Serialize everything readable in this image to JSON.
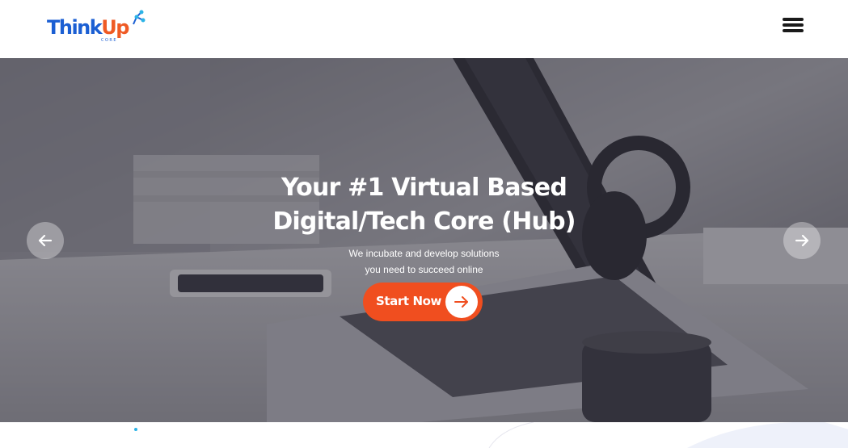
{
  "header": {
    "logo": {
      "brand_part1": "Think",
      "brand_part2": "Up",
      "sub": "CORE"
    },
    "menu_icon": "hamburger-menu-icon"
  },
  "hero": {
    "title_line1": "Your #1 Virtual Based",
    "title_line2": "Digital/Tech Core (Hub)",
    "subtitle_line1": "We incubate and develop solutions",
    "subtitle_line2": "you need to succeed online",
    "cta_label": "Start Now",
    "cta_icon": "arrow-right-icon",
    "prev_icon": "arrow-left-icon",
    "next_icon": "arrow-right-icon"
  },
  "colors": {
    "brand_blue": "#1b5fd3",
    "brand_orange": "#ef5a24",
    "cta": "#f04e1f",
    "accent_cyan": "#2bb3e6"
  }
}
